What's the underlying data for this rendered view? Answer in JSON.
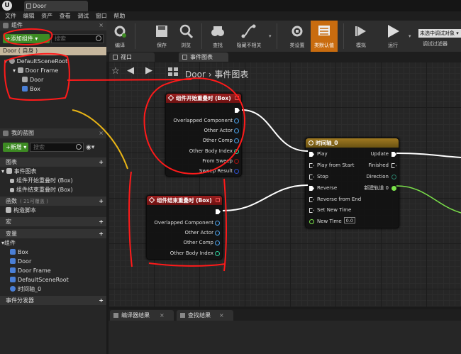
{
  "app": {
    "logo_letter": "U",
    "tab_title": "Door",
    "menu": [
      "文件",
      "编辑",
      "资产",
      "查看",
      "调试",
      "窗口",
      "帮助"
    ]
  },
  "components_panel": {
    "title": "组件",
    "add_button": "+添加组件 ▾",
    "search_placeholder": "搜索",
    "self_row": "Door ( 自身 )",
    "tree": [
      "DefaultSceneRoot",
      "Door Frame",
      "Door",
      "Box"
    ]
  },
  "blueprint_panel": {
    "title": "我的蓝图",
    "new_button": "+新增 ▾",
    "search_placeholder": "搜索",
    "graphs_header": "图表",
    "event_graph": "事件图表",
    "events": [
      "组件开始重叠时 (Box)",
      "组件结束重叠时 (Box)"
    ],
    "functions_header": "函数",
    "functions_hint": "( 21可覆盖 )",
    "construction_script": "构造脚本",
    "macros_header": "宏",
    "variables_header": "变量",
    "components_group": "组件",
    "variables": [
      "Box",
      "Door",
      "Door Frame",
      "DefaultSceneRoot",
      "时间轴_0"
    ],
    "dispatchers_header": "事件分发器"
  },
  "toolbar": {
    "compile": "编译",
    "save": "保存",
    "browse": "浏览",
    "find": "查找",
    "hide_unrelated": "隐藏不相关",
    "class_settings": "类设置",
    "class_defaults": "类默认值",
    "simulate": "模拟",
    "play": "运行",
    "debug_select": "未选中调试对象 ▾",
    "debug_filter": "调试过滤器"
  },
  "editor_tabs": {
    "viewport": "视口",
    "event_graph": "事件图表"
  },
  "breadcrumb": {
    "root": "Door",
    "arrow": "›",
    "current": "事件图表"
  },
  "nodes": {
    "begin_overlap": {
      "title": "组件开始重叠时 (Box)",
      "pins": [
        "Overlapped Component",
        "Other Actor",
        "Other Comp",
        "Other Body Index",
        "From Sweep",
        "Sweep Result"
      ]
    },
    "end_overlap": {
      "title": "组件结束重叠时 (Box)",
      "pins": [
        "Overlapped Component",
        "Other Actor",
        "Other Comp",
        "Other Body Index"
      ]
    },
    "timeline": {
      "title": "时间轴_0",
      "inputs": [
        "Play",
        "Play from Start",
        "Stop",
        "Reverse",
        "Reverse from End",
        "Set New Time",
        "New Time"
      ],
      "new_time_value": "0.0",
      "outputs": [
        "Update",
        "Finished",
        "Direction",
        "新建轨道 0"
      ]
    }
  },
  "bottom_tabs": {
    "compiler_results": "编译器结果",
    "find_results": "查找结果"
  },
  "colors": {
    "event_header": "#8c1a1a",
    "timeline_header": "#8a6a1a",
    "active_tool": "#c96c0f",
    "green_button": "#3d8b23",
    "annotation_red": "#ff1a1a",
    "annotation_yellow": "#e8b416"
  }
}
